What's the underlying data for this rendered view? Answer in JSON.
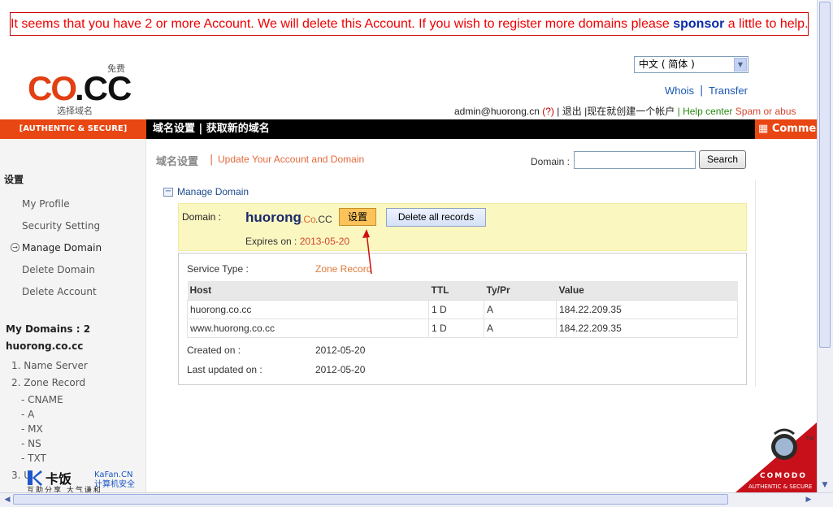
{
  "notice": {
    "text_before": "It seems that you have 2 or more Account. We will delete this Account. If you wish to register more domains please ",
    "link": "sponsor",
    "text_after": " a little to help."
  },
  "logo": {
    "brand_co": "CO",
    "brand_cc": ".CC",
    "free": "免费",
    "subtitle": "选择域名"
  },
  "language_select": {
    "selected": "中文 ( 简体 )"
  },
  "toplinks": {
    "whois": "Whois",
    "separator": "|",
    "transfer": "Transfer"
  },
  "userline": {
    "email": "admin@huorong.cn",
    "help_q": "(?)",
    "sep": "|",
    "logout": "退出",
    "create": "现在就创建一个帐户",
    "help_center": "Help center",
    "spam": "Spam or abus"
  },
  "nav": {
    "left_badge": "[AUTHENTIC & SECURE]",
    "links": "域名设置  |  获取新的域名",
    "comment": "Comme"
  },
  "sidebar": {
    "heading": "设置",
    "items": [
      "My Profile",
      "Security Setting",
      "Manage Domain",
      "Delete Domain",
      "Delete Account"
    ],
    "my_domains": "My Domains : 2",
    "domain": "huorong.co.cc",
    "sections": [
      "1. Name Server",
      "2. Zone Record"
    ],
    "records": [
      "- CNAME",
      "- A",
      "- MX",
      "- NS",
      "- TXT"
    ],
    "section3": "3. U"
  },
  "breadcrumb": {
    "first": "域名设置",
    "sep": "|",
    "second": "Update Your Account and Domain"
  },
  "search": {
    "label": "Domain :",
    "value": "",
    "button": "Search"
  },
  "manage": {
    "title": "Manage Domain"
  },
  "domain_box": {
    "label": "Domain :",
    "name": "huorong",
    "suffix_co": ".Co",
    "suffix_cc": ".CC",
    "set_button": "设置",
    "delete_button": "Delete all records",
    "expires_label": "Expires on :",
    "expires_value": "2013-05-20"
  },
  "detail": {
    "service_label": "Service Type :",
    "service_value": "Zone Record",
    "columns": [
      "Host",
      "TTL",
      "Ty/Pr",
      "Value"
    ],
    "rows": [
      [
        "huorong.co.cc",
        "1 D",
        "A",
        "184.22.209.35"
      ],
      [
        "www.huorong.co.cc",
        "1 D",
        "A",
        "184.22.209.35"
      ]
    ],
    "created_label": "Created on :",
    "created_value": "2012-05-20",
    "updated_label": "Last updated on :",
    "updated_value": "2012-05-20"
  },
  "comodo": {
    "brand": "COMODO",
    "tagline": "AUTHENTIC & SECURE",
    "tm": "TM"
  },
  "watermark": {
    "brand": "卡饭",
    "site": "KaFan.CN",
    "tag": "计算机安全",
    "motto": "互助分享  大气谦和"
  },
  "colors": {
    "accent_orange": "#e84612",
    "notice_red": "#ee0000",
    "link_blue": "#1a57b4",
    "highlight_yellow": "#fbf7c1"
  }
}
